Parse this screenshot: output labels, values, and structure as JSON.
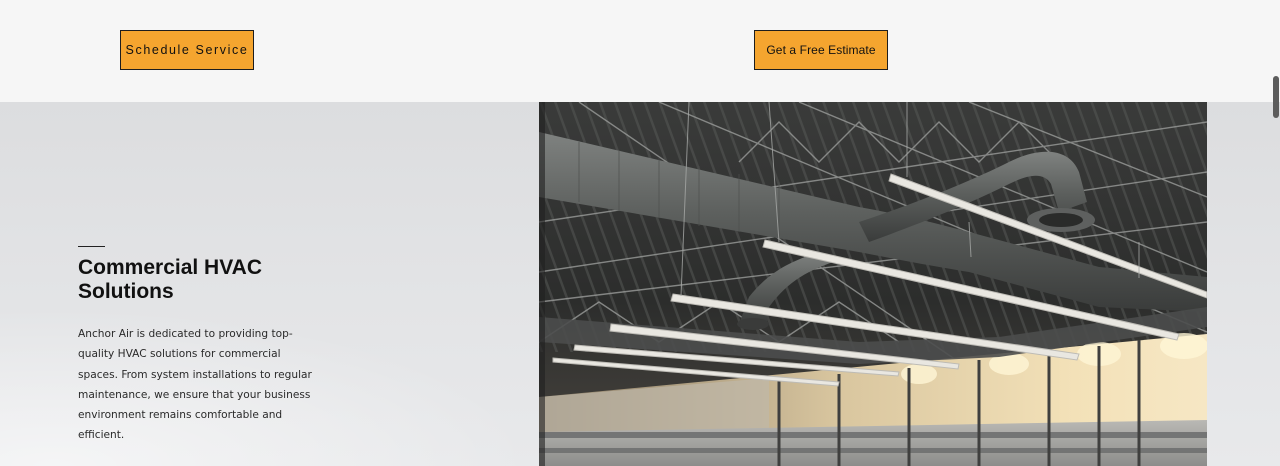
{
  "header": {
    "schedule_label": "Schedule Service",
    "estimate_label": "Get a Free Estimate"
  },
  "section": {
    "title": "Commercial HVAC Solutions",
    "description": "Anchor Air is dedicated to providing top-quality HVAC solutions for commercial spaces. From system installations to regular maintenance, we ensure that your business environment remains comfortable and efficient."
  },
  "photo": {
    "subject": "commercial-ductwork-ceiling-photo"
  },
  "colors": {
    "button_bg": "#f5a52f",
    "page_bg": "#f6f6f6",
    "section_bg": "#e1e2e4",
    "text": "#111111"
  }
}
